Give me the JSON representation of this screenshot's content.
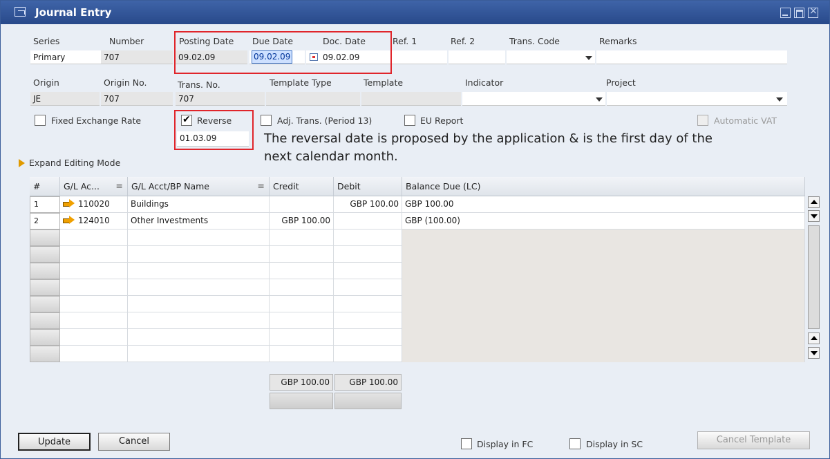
{
  "window": {
    "title": "Journal Entry"
  },
  "header": {
    "series_label": "Series",
    "series_value": "Primary",
    "number_label": "Number",
    "number_value": "707",
    "posting_date_label": "Posting Date",
    "posting_date_value": "09.02.09",
    "due_date_label": "Due Date",
    "due_date_value": "09.02.09",
    "doc_date_label": "Doc. Date",
    "doc_date_value": "09.02.09",
    "ref1_label": "Ref. 1",
    "ref2_label": "Ref. 2",
    "trans_code_label": "Trans. Code",
    "remarks_label": "Remarks",
    "origin_label": "Origin",
    "origin_value": "JE",
    "origin_no_label": "Origin No.",
    "origin_no_value": "707",
    "trans_no_label": "Trans. No.",
    "trans_no_value": "707",
    "template_type_label": "Template Type",
    "template_label": "Template",
    "indicator_label": "Indicator",
    "project_label": "Project"
  },
  "options": {
    "fixed_exchange_rate": {
      "label": "Fixed Exchange Rate",
      "checked": false
    },
    "reverse": {
      "label": "Reverse",
      "checked": true,
      "date": "01.03.09"
    },
    "adj_trans": {
      "label": "Adj. Trans. (Period 13)",
      "checked": false
    },
    "eu_report": {
      "label": "EU Report",
      "checked": false
    },
    "automatic_vat": {
      "label": "Automatic VAT",
      "checked": false,
      "disabled": true
    }
  },
  "annotation": {
    "line1": "The reversal date is proposed by the application & is the first day of the",
    "line2": "next calendar month."
  },
  "expand_editing_mode": "Expand Editing Mode",
  "grid": {
    "columns": [
      "#",
      "G/L Ac...",
      "G/L Acct/BP Name",
      "Credit",
      "Debit",
      "Balance Due (LC)"
    ],
    "rows": [
      {
        "num": "1",
        "account": "110020",
        "name": "Buildings",
        "credit": "",
        "debit": "GBP 100.00",
        "balance": "GBP  100.00"
      },
      {
        "num": "2",
        "account": "124010",
        "name": "Other Investments",
        "credit": "GBP 100.00",
        "debit": "",
        "balance": "GBP (100.00)"
      }
    ],
    "totals": {
      "credit": "GBP 100.00",
      "debit": "GBP 100.00"
    }
  },
  "footer": {
    "update_button": "Update",
    "cancel_button": "Cancel",
    "display_fc": "Display in FC",
    "display_sc": "Display in SC",
    "cancel_template_button": "Cancel Template"
  },
  "colors": {
    "title_bar": "#2f5194",
    "highlight_box": "#e0252b",
    "arrow_icon": "#f0a000"
  }
}
